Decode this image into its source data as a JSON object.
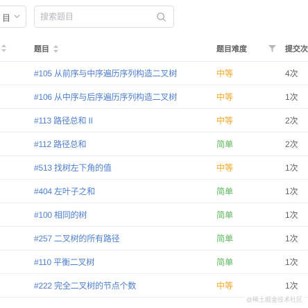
{
  "toolbar": {
    "select_value": "目",
    "search_placeholder": "搜索题目"
  },
  "table": {
    "headers": {
      "title": "题目",
      "difficulty": "题目难度",
      "submissions": "提交次"
    },
    "rows": [
      {
        "title": "#105 从前序与中序遍历序列构造二叉树",
        "difficulty": "中等",
        "submissions": "4次"
      },
      {
        "title": "#106 从中序与后序遍历序列构造二叉树",
        "difficulty": "中等",
        "submissions": "1次"
      },
      {
        "title": "#113 路径总和 II",
        "difficulty": "中等",
        "submissions": "2次"
      },
      {
        "title": "#112 路径总和",
        "difficulty": "简单",
        "submissions": "2次"
      },
      {
        "title": "#513 找树左下角的值",
        "difficulty": "中等",
        "submissions": "1次"
      },
      {
        "title": "#404 左叶子之和",
        "difficulty": "简单",
        "submissions": "1次"
      },
      {
        "title": "#100 相同的树",
        "difficulty": "简单",
        "submissions": "1次"
      },
      {
        "title": "#257 二叉树的所有路径",
        "difficulty": "简单",
        "submissions": "1次"
      },
      {
        "title": "#110 平衡二叉树",
        "difficulty": "简单",
        "submissions": "1次"
      },
      {
        "title": "#222 完全二叉树的节点个数",
        "difficulty": "中等",
        "submissions": "1次"
      }
    ]
  },
  "colors": {
    "link": "#4d7fd0",
    "medium": "#f5a623",
    "easy": "#5cb85c"
  },
  "watermark": "@稀土掘金技术社区"
}
